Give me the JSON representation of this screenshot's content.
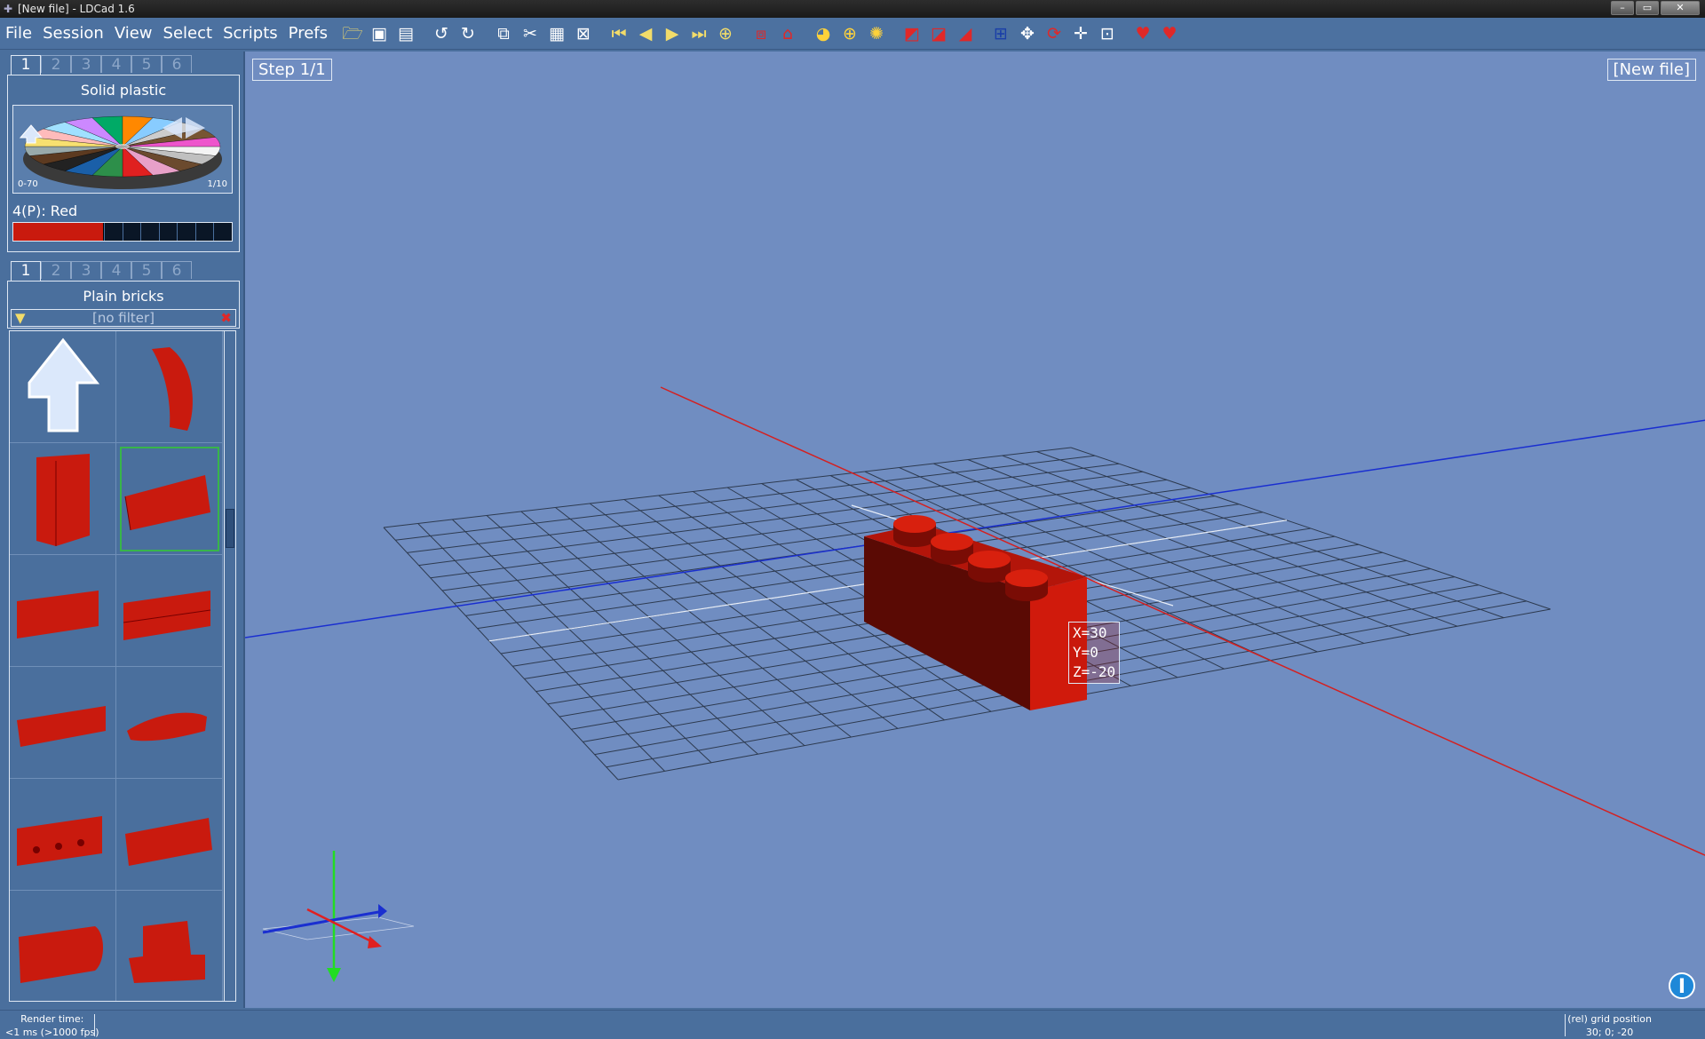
{
  "window": {
    "title": "[New file] - LDCad 1.6",
    "controls": [
      "minimize",
      "maximize",
      "close"
    ]
  },
  "menu": [
    "File",
    "Session",
    "View",
    "Select",
    "Scripts",
    "Prefs"
  ],
  "toolbar": {
    "icons": [
      "open-folder-icon",
      "save-icon",
      "save-all-icon",
      "undo-icon",
      "redo-icon",
      "copy-icon",
      "cut-icon",
      "paste-icon",
      "select-special-icon",
      "first-step-icon",
      "prev-step-icon",
      "next-step-icon",
      "last-step-icon",
      "add-step-icon",
      "submodel-icon",
      "new-submodel-icon",
      "color-ring-icon",
      "color-add-icon",
      "color-pick-icon",
      "hide-icon",
      "hide-toggle-icon",
      "unhide-icon",
      "grid-mode-icon",
      "move-icon",
      "rotate-icon",
      "pan-icon",
      "grid-snap-icon",
      "favorite-icon",
      "favorite-add-icon"
    ]
  },
  "color_panel": {
    "tabs": [
      "1",
      "2",
      "3",
      "4",
      "5",
      "6"
    ],
    "active_tab": "1",
    "title": "Solid plastic",
    "wheel_range_left": "0-70",
    "wheel_range_right": "1/10",
    "selected_color_label": "4(P): Red",
    "selected_color_hex": "#c91a0e"
  },
  "parts_panel": {
    "tabs": [
      "1",
      "2",
      "3",
      "4",
      "5",
      "6"
    ],
    "active_tab": "1",
    "title": "Plain bricks",
    "filter_text": "[no filter]",
    "parts": [
      "up-arrow-part",
      "arch-brick-part",
      "tall-brick-part",
      "brick-1x4-part",
      "round-brick-4-part",
      "brick-1x4-studs-side-part",
      "plate-1x4-part",
      "curved-slope-part",
      "technic-brick-part",
      "brick-1x3-part",
      "cylinder-part",
      "brick-with-bracket-part"
    ],
    "selected_index": 3
  },
  "viewport": {
    "step_label": "Step 1/1",
    "file_label": "[New file]",
    "coords": {
      "x": "X=30",
      "y": "Y=0",
      "z": "Z=-20"
    }
  },
  "status": {
    "render_label": "Render time:",
    "render_value": "<1 ms (>1000 fps)",
    "grid_label": "(rel) grid position",
    "grid_value": "30; 0; -20"
  },
  "colors": {
    "background": "#4a6f9d",
    "viewport": "#708dc1",
    "brick": "#c91a0e",
    "axis_red": "#d42020",
    "axis_blue": "#1a2fd0",
    "axis_green": "#22dd22",
    "selection": "#38b54a"
  }
}
